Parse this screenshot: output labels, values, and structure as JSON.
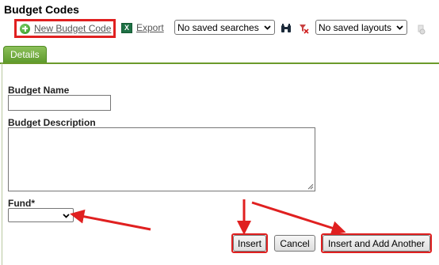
{
  "page": {
    "title": "Budget Codes"
  },
  "toolbar": {
    "new_label": "New Budget Code",
    "export_label": "Export",
    "excel_glyph": "X",
    "saved_searches": "No saved searches",
    "saved_layouts": "No saved layouts",
    "icons": [
      "plus-circle-icon",
      "excel-icon",
      "binoculars-icon",
      "filter-clear-icon",
      "settings-icon"
    ]
  },
  "tabs": [
    {
      "label": "Details",
      "active": true
    }
  ],
  "form": {
    "budget_name_label": "Budget Name",
    "budget_name_value": "",
    "budget_description_label": "Budget Description",
    "budget_description_value": "",
    "fund_label": "Fund*",
    "fund_value": ""
  },
  "buttons": {
    "insert": "Insert",
    "cancel": "Cancel",
    "insert_add_another": "Insert and Add Another"
  },
  "colors": {
    "highlight": "#e02020",
    "tab_green": "#6b9a2b",
    "link_gray": "#555555"
  }
}
